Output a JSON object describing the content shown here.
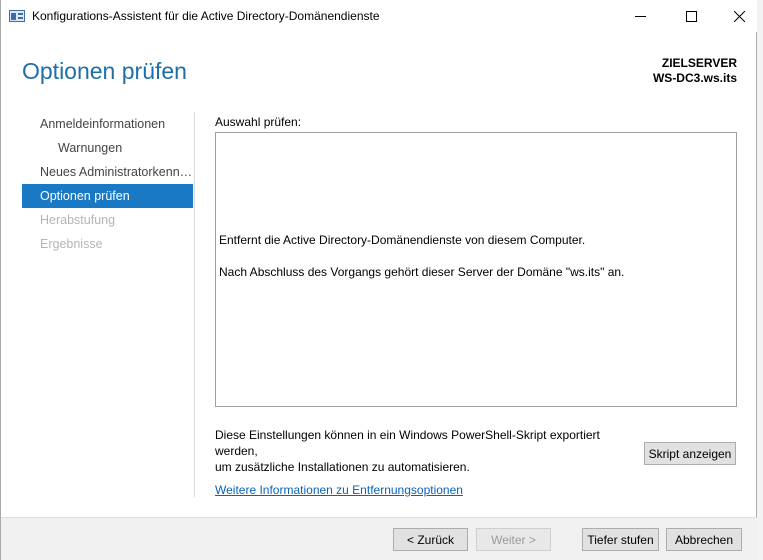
{
  "window": {
    "title": "Konfigurations-Assistent für die Active Directory-Domänendienste",
    "controls": {
      "minimize": "—",
      "maximize": "☐",
      "close": "✕"
    }
  },
  "header": {
    "page_title": "Optionen prüfen",
    "target_label": "ZIELSERVER",
    "target_server": "WS-DC3.ws.its"
  },
  "nav": {
    "items": [
      {
        "label": "Anmeldeinformationen",
        "state": "normal"
      },
      {
        "label": "Warnungen",
        "state": "sub"
      },
      {
        "label": "Neues Administratorkennwort",
        "state": "normal"
      },
      {
        "label": "Optionen prüfen",
        "state": "active"
      },
      {
        "label": "Herabstufung",
        "state": "disabled"
      },
      {
        "label": "Ergebnisse",
        "state": "disabled"
      }
    ]
  },
  "main": {
    "review_label": "Auswahl prüfen:",
    "review_line1": "Entfernt die Active Directory-Domänendienste von diesem Computer.",
    "review_line2": "Nach Abschluss des Vorgangs gehört dieser Server der Domäne \"ws.its\" an.",
    "export_text_line1": "Diese Einstellungen können in ein Windows PowerShell-Skript exportiert werden,",
    "export_text_line2": "um zusätzliche Installationen zu automatisieren.",
    "script_button": "Skript anzeigen",
    "info_link": "Weitere Informationen zu Entfernungsoptionen"
  },
  "footer": {
    "back": "< Zurück",
    "next": "Weiter >",
    "demote": "Tiefer stufen",
    "cancel": "Abbrechen"
  },
  "colors": {
    "accent": "#1979c5",
    "title": "#1e6fa8",
    "link": "#0a63b8"
  }
}
